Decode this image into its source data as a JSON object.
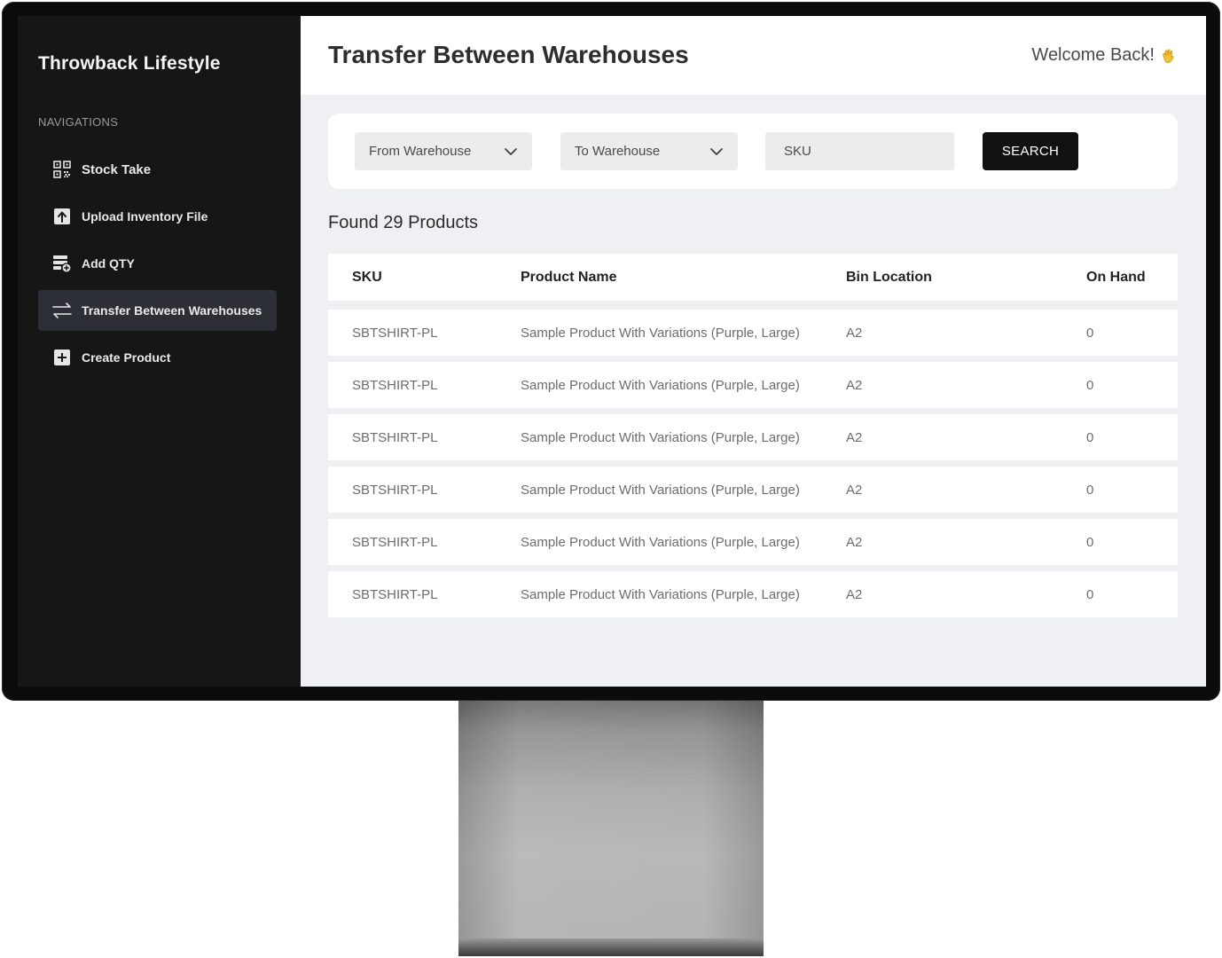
{
  "sidebar": {
    "brand": "Throwback Lifestyle",
    "heading": "NAVIGATIONS",
    "items": [
      {
        "label": "Stock Take",
        "icon": "qr-code-icon",
        "active": false
      },
      {
        "label": "Upload Inventory File",
        "icon": "upload-icon",
        "active": false
      },
      {
        "label": "Add QTY",
        "icon": "add-quantity-icon",
        "active": false
      },
      {
        "label": "Transfer Between Warehouses",
        "icon": "transfer-arrows-icon",
        "active": true
      },
      {
        "label": "Create Product",
        "icon": "plus-square-icon",
        "active": false
      }
    ]
  },
  "header": {
    "title": "Transfer Between Warehouses",
    "welcome": "Welcome Back!",
    "welcome_icon": "waving-hand-icon"
  },
  "filters": {
    "from_warehouse": "From Warehouse",
    "to_warehouse": "To Warehouse",
    "sku_placeholder": "SKU",
    "search_label": "SEARCH"
  },
  "results": {
    "summary": "Found 29 Products"
  },
  "table": {
    "columns": [
      "SKU",
      "Product Name",
      "Bin Location",
      "On Hand"
    ],
    "rows": [
      {
        "sku": "SBTSHIRT-PL",
        "name": "Sample Product With Variations (Purple, Large)",
        "bin": "A2",
        "on_hand": "0"
      },
      {
        "sku": "SBTSHIRT-PL",
        "name": "Sample Product With Variations (Purple, Large)",
        "bin": "A2",
        "on_hand": "0"
      },
      {
        "sku": "SBTSHIRT-PL",
        "name": "Sample Product With Variations (Purple, Large)",
        "bin": "A2",
        "on_hand": "0"
      },
      {
        "sku": "SBTSHIRT-PL",
        "name": "Sample Product With Variations (Purple, Large)",
        "bin": "A2",
        "on_hand": "0"
      },
      {
        "sku": "SBTSHIRT-PL",
        "name": "Sample Product With Variations (Purple, Large)",
        "bin": "A2",
        "on_hand": "0"
      },
      {
        "sku": "SBTSHIRT-PL",
        "name": "Sample Product With Variations (Purple, Large)",
        "bin": "A2",
        "on_hand": "0"
      }
    ]
  },
  "colors": {
    "sidebar_bg": "#161616",
    "active_item_bg": "#2c2f35",
    "content_bg": "#eef0f3",
    "button_bg": "#111111"
  }
}
